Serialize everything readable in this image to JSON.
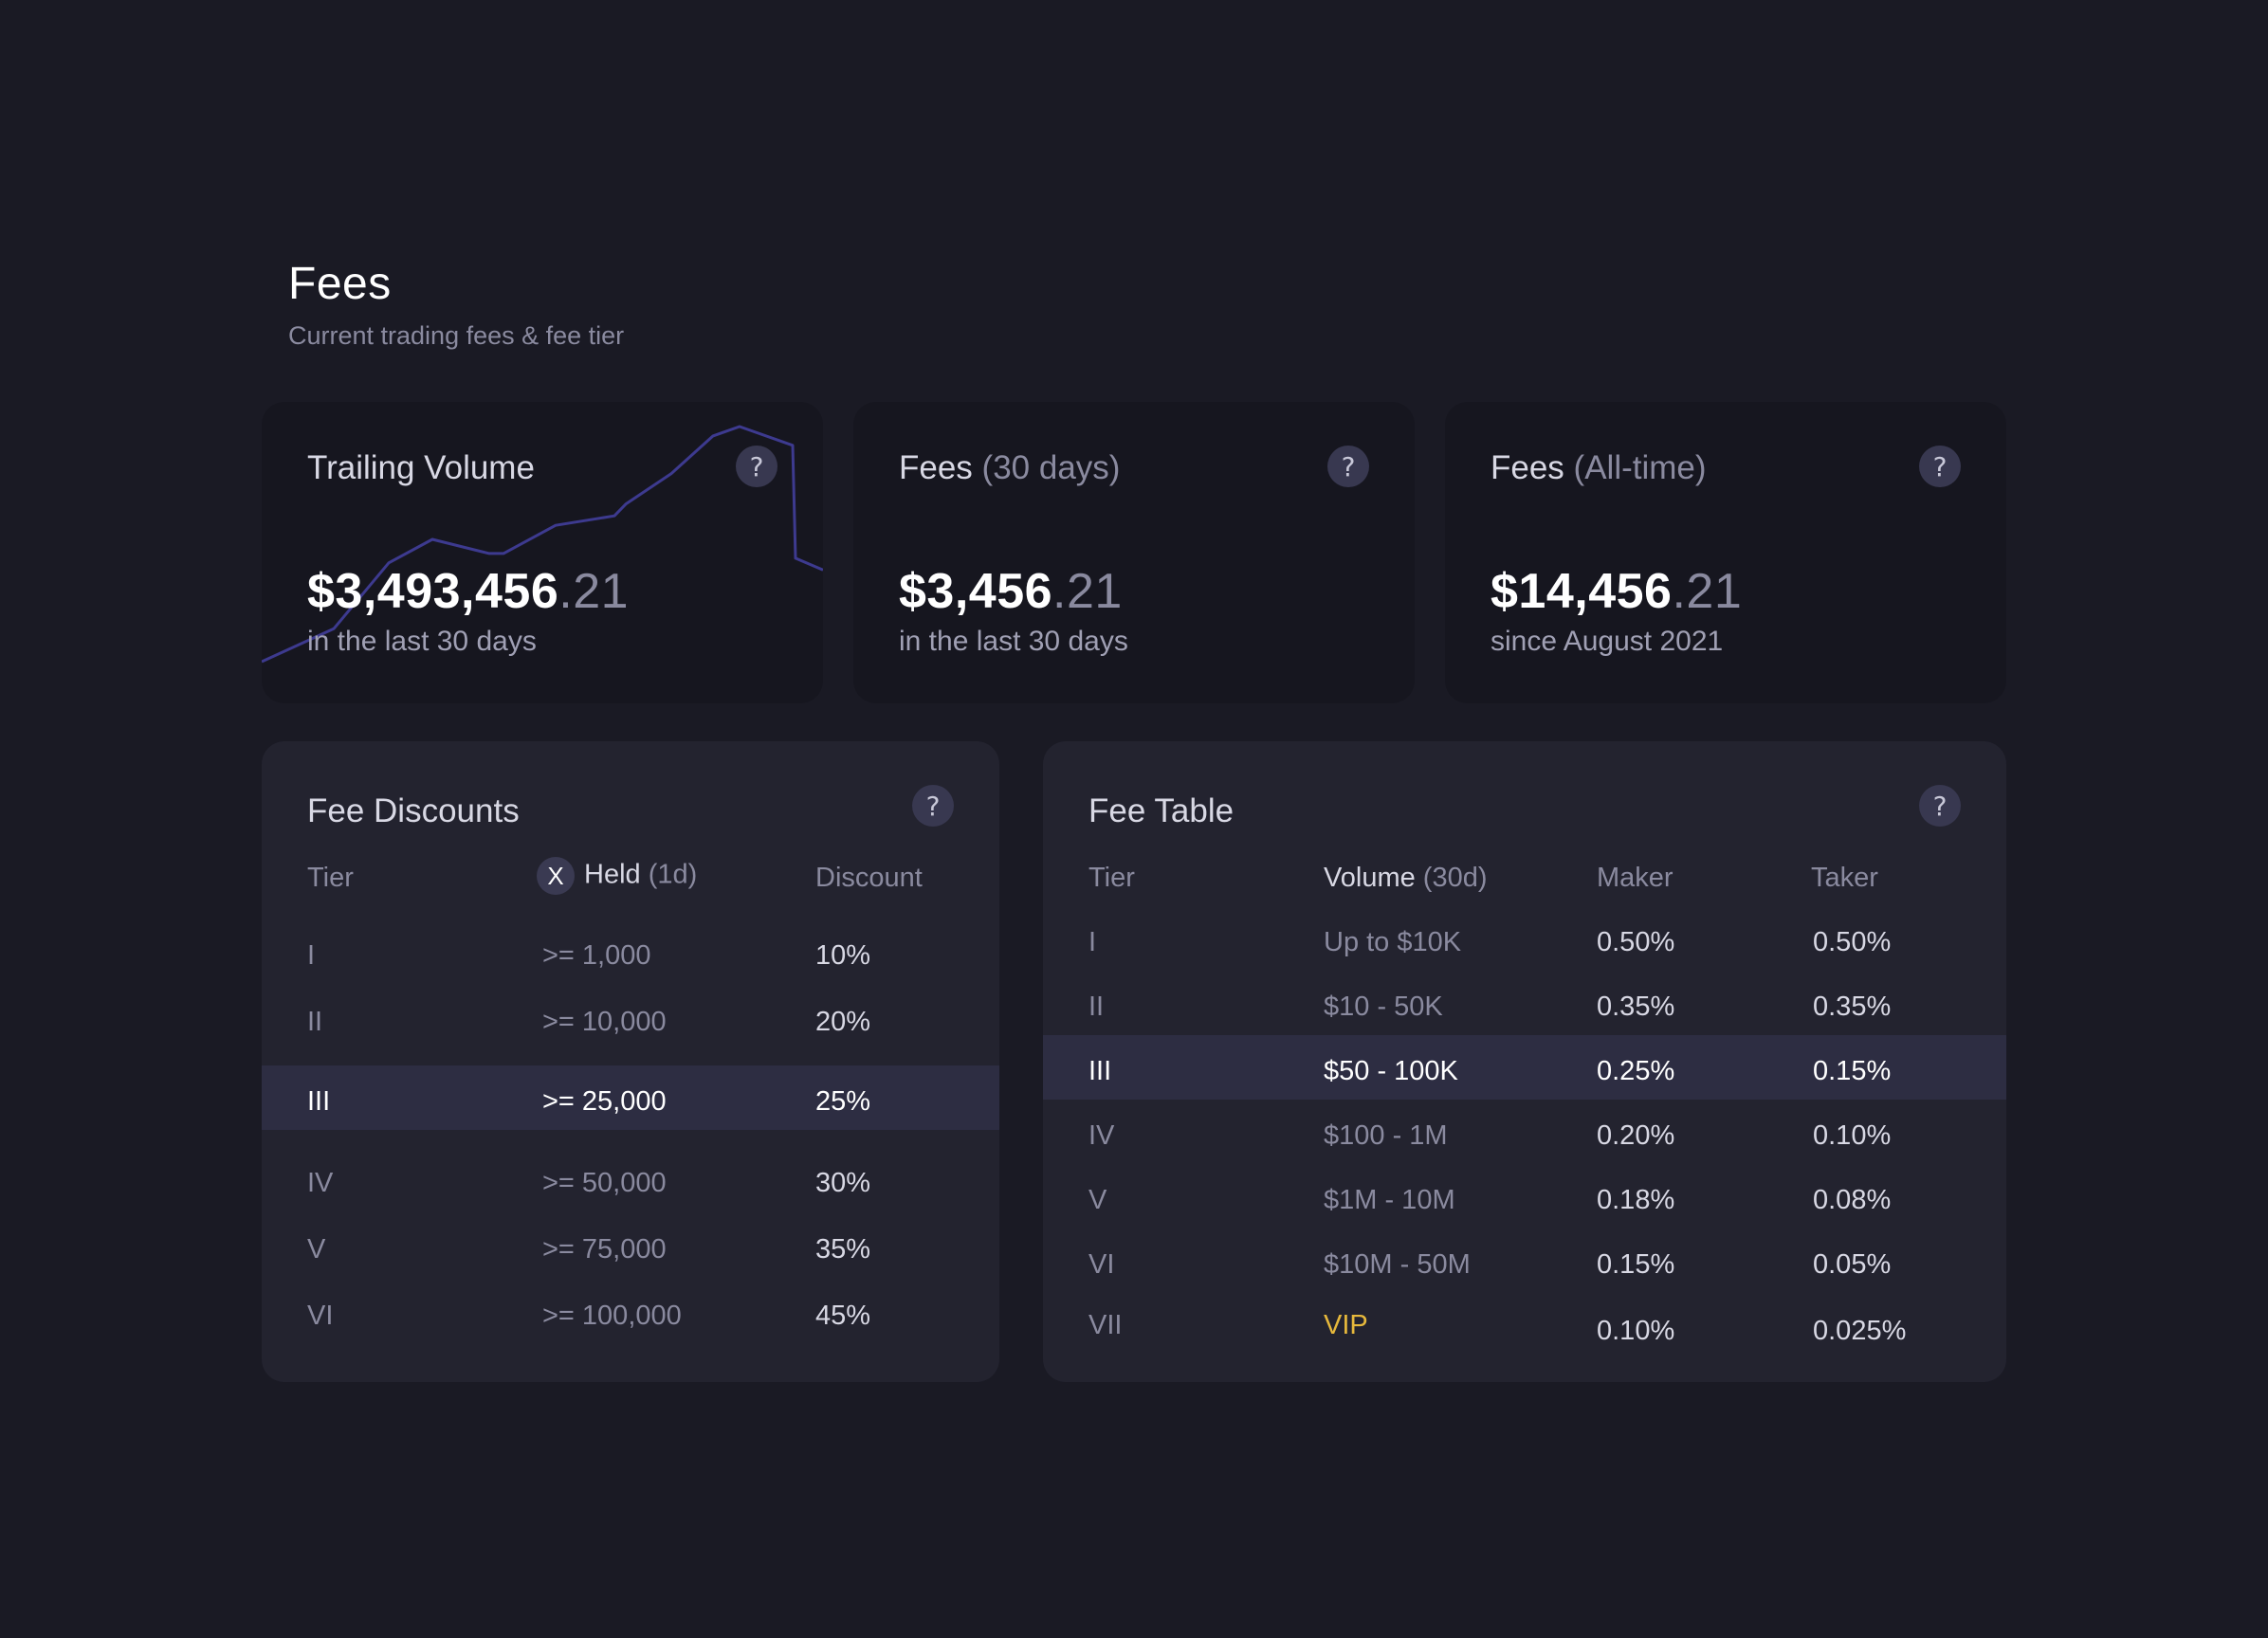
{
  "header": {
    "title": "Fees",
    "subtitle": "Current trading fees & fee tier"
  },
  "stats": [
    {
      "title": "Trailing Volume",
      "title_muted": "",
      "value_main": "$3,493,456",
      "value_decimals": ".21",
      "caption": "in the last 30 days",
      "help": "?"
    },
    {
      "title": "Fees ",
      "title_muted": "(30 days)",
      "value_main": "$3,456",
      "value_decimals": ".21",
      "caption": "in the last 30 days",
      "help": "?"
    },
    {
      "title": "Fees ",
      "title_muted": "(All-time)",
      "value_main": "$14,456",
      "value_decimals": ".21",
      "caption": "since August 2021",
      "help": "?"
    }
  ],
  "sparkline": {
    "color": "#3d3a8f",
    "values": [
      0,
      14,
      42,
      52,
      46,
      46,
      58,
      62,
      67,
      80,
      96,
      100,
      92,
      44,
      39
    ]
  },
  "fee_discounts": {
    "title": "Fee Discounts",
    "help": "?",
    "headers": {
      "tier": "Tier",
      "token_icon": "X",
      "held": "Held",
      "held_muted": " (1d)",
      "discount": "Discount"
    },
    "highlighted_row": 2,
    "rows": [
      {
        "tier": "I",
        "held": ">= 1,000",
        "discount": "10%"
      },
      {
        "tier": "II",
        "held": ">= 10,000",
        "discount": "20%"
      },
      {
        "tier": "III",
        "held": ">= 25,000",
        "discount": "25%"
      },
      {
        "tier": "IV",
        "held": ">= 50,000",
        "discount": "30%"
      },
      {
        "tier": "V",
        "held": ">= 75,000",
        "discount": "35%"
      },
      {
        "tier": "VI",
        "held": ">= 100,000",
        "discount": "45%"
      }
    ]
  },
  "fee_table": {
    "title": "Fee Table",
    "help": "?",
    "headers": {
      "tier": "Tier",
      "volume": "Volume",
      "volume_muted": " (30d)",
      "maker": "Maker",
      "taker": "Taker"
    },
    "highlighted_row": 2,
    "vip_color": "#e6b83c",
    "rows": [
      {
        "tier": "I",
        "volume": "Up to $10K",
        "maker": "0.50%",
        "taker": "0.50%"
      },
      {
        "tier": "II",
        "volume": "$10 - 50K",
        "maker": "0.35%",
        "taker": "0.35%"
      },
      {
        "tier": "III",
        "volume": "$50 - 100K",
        "maker": "0.25%",
        "taker": "0.15%"
      },
      {
        "tier": "IV",
        "volume": "$100 - 1M",
        "maker": "0.20%",
        "taker": "0.10%"
      },
      {
        "tier": "V",
        "volume": "$1M - 10M",
        "maker": "0.18%",
        "taker": "0.08%"
      },
      {
        "tier": "VI",
        "volume": "$10M - 50M",
        "maker": "0.15%",
        "taker": "0.05%"
      },
      {
        "tier": "VII",
        "volume": "VIP",
        "maker": "0.10%",
        "taker": "0.025%"
      }
    ]
  }
}
